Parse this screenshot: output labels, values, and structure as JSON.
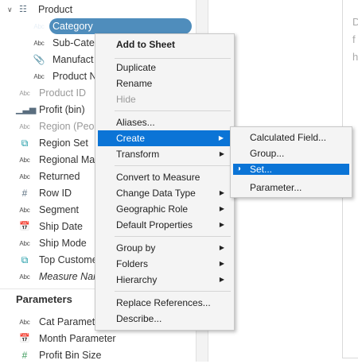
{
  "data_pane": {
    "product_group": {
      "label": "Product",
      "expand_icon": "chevron-down-icon",
      "hierarchy_icon": "hierarchy-icon"
    },
    "hierarchy_fields": [
      {
        "icon": "Abc",
        "label": "Category",
        "selected": true
      },
      {
        "icon": "Abc",
        "label": "Sub-Cate"
      },
      {
        "icon": "paperclip",
        "label": "Manufact"
      },
      {
        "icon": "Abc",
        "label": "Product N"
      }
    ],
    "fields": [
      {
        "icon": "Abc",
        "label": "Product ID",
        "style": "dim"
      },
      {
        "icon": "bin-bars",
        "label": "Profit (bin)"
      },
      {
        "icon": "Abc",
        "label": "Region (Peop",
        "style": "dim"
      },
      {
        "icon": "set",
        "label": "Region Set"
      },
      {
        "icon": "Abc",
        "label": "Regional Mar"
      },
      {
        "icon": "Abc",
        "label": "Returned"
      },
      {
        "icon": "#",
        "label": "Row ID"
      },
      {
        "icon": "Abc",
        "label": "Segment"
      },
      {
        "icon": "calendar",
        "label": "Ship Date"
      },
      {
        "icon": "Abc",
        "label": "Ship Mode"
      },
      {
        "icon": "set",
        "label": "Top Custome"
      },
      {
        "icon": "Abc",
        "label": "Measure Nar",
        "style": "italic"
      }
    ],
    "parameters_title": "Parameters",
    "parameters": [
      {
        "icon": "Abc",
        "label": "Cat Paramet"
      },
      {
        "icon": "calendar",
        "label": "Month Parameter"
      },
      {
        "icon": "#",
        "label": "Profit Bin Size"
      }
    ]
  },
  "ghost_text": [
    "D",
    "f",
    "h"
  ],
  "context_menu": {
    "items": [
      {
        "label": "Add to Sheet",
        "bold": true
      },
      {
        "sep": true
      },
      {
        "label": "Duplicate"
      },
      {
        "label": "Rename"
      },
      {
        "label": "Hide",
        "disabled": true
      },
      {
        "sep": true
      },
      {
        "label": "Aliases..."
      },
      {
        "label": "Create",
        "submenu": true,
        "highlighted": true
      },
      {
        "label": "Transform",
        "submenu": true
      },
      {
        "sep": true
      },
      {
        "label": "Convert to Measure"
      },
      {
        "label": "Change Data Type",
        "submenu": true
      },
      {
        "label": "Geographic Role",
        "submenu": true
      },
      {
        "label": "Default Properties",
        "submenu": true
      },
      {
        "sep": true
      },
      {
        "label": "Group by",
        "submenu": true
      },
      {
        "label": "Folders",
        "submenu": true
      },
      {
        "label": "Hierarchy",
        "submenu": true
      },
      {
        "sep": true
      },
      {
        "label": "Replace References..."
      },
      {
        "label": "Describe..."
      }
    ]
  },
  "create_submenu": {
    "items": [
      {
        "label": "Calculated Field..."
      },
      {
        "label": "Group..."
      },
      {
        "label": "Set...",
        "highlighted": true,
        "icon": "set-icon"
      },
      {
        "label": "Parameter..."
      }
    ]
  },
  "colors": {
    "selection_pill": "#4f8dbc",
    "menu_highlight": "#0b74d6",
    "set_icon": "#1a9aa6"
  }
}
